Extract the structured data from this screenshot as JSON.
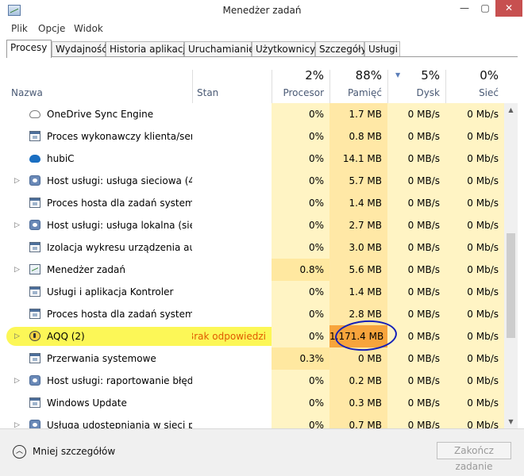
{
  "window": {
    "title": "Menedżer zadań",
    "minimize": "—",
    "maximize": "▢",
    "close": "✕"
  },
  "menu": {
    "items": [
      "Plik",
      "Opcje",
      "Widok"
    ]
  },
  "tabs": [
    "Procesy",
    "Wydajność",
    "Historia aplikacji",
    "Uruchamianie",
    "Użytkownicy",
    "Szczegóły",
    "Usługi"
  ],
  "active_tab": "Procesy",
  "columns": {
    "name": "Nazwa",
    "status": "Stan",
    "cpu": {
      "label": "Procesor",
      "percent": "2%"
    },
    "memory": {
      "label": "Pamięć",
      "percent": "88%"
    },
    "disk": {
      "label": "Dysk",
      "percent": "5%"
    },
    "network": {
      "label": "Sieć",
      "percent": "0%"
    }
  },
  "rows": [
    {
      "name": "OneDrive Sync Engine",
      "status": "",
      "cpu": "0%",
      "mem": "1.7 MB",
      "disk": "0 MB/s",
      "net": "0 Mb/s",
      "icon": "cloud-outline-icon",
      "expandable": false
    },
    {
      "name": "Proces wykonawczy klienta/ser...",
      "status": "",
      "cpu": "0%",
      "mem": "0.8 MB",
      "disk": "0 MB/s",
      "net": "0 Mb/s",
      "icon": "window-icon",
      "expandable": false
    },
    {
      "name": "hubiC",
      "status": "",
      "cpu": "0%",
      "mem": "14.1 MB",
      "disk": "0 MB/s",
      "net": "0 Mb/s",
      "icon": "cloud-icon",
      "expandable": false
    },
    {
      "name": "Host usługi: usługa sieciowa (4)",
      "status": "",
      "cpu": "0%",
      "mem": "5.7 MB",
      "disk": "0 MB/s",
      "net": "0 Mb/s",
      "icon": "gear-icon",
      "expandable": true
    },
    {
      "name": "Proces hosta dla zadań systemu...",
      "status": "",
      "cpu": "0%",
      "mem": "1.4 MB",
      "disk": "0 MB/s",
      "net": "0 Mb/s",
      "icon": "window-icon",
      "expandable": false
    },
    {
      "name": "Host usługi: usługa lokalna (sieć...",
      "status": "",
      "cpu": "0%",
      "mem": "2.7 MB",
      "disk": "0 MB/s",
      "net": "0 Mb/s",
      "icon": "gear-icon",
      "expandable": true
    },
    {
      "name": "Izolacja wykresu urządzenia aud...",
      "status": "",
      "cpu": "0%",
      "mem": "3.0 MB",
      "disk": "0 MB/s",
      "net": "0 Mb/s",
      "icon": "window-icon",
      "expandable": false
    },
    {
      "name": "Menedżer zadań",
      "status": "",
      "cpu": "0.8%",
      "mem": "5.6 MB",
      "disk": "0 MB/s",
      "net": "0 Mb/s",
      "icon": "task-manager-icon",
      "expandable": true
    },
    {
      "name": "Usługi i aplikacja Kontroler",
      "status": "",
      "cpu": "0%",
      "mem": "1.4 MB",
      "disk": "0 MB/s",
      "net": "0 Mb/s",
      "icon": "window-icon",
      "expandable": false
    },
    {
      "name": "Proces hosta dla zadań systemu...",
      "status": "",
      "cpu": "0%",
      "mem": "2.8 MB",
      "disk": "0 MB/s",
      "net": "0 Mb/s",
      "icon": "window-icon",
      "expandable": false
    },
    {
      "name": "AQQ (2)",
      "status": "Brak odpowiedzi",
      "cpu": "0%",
      "mem": "1,171.4 MB",
      "disk": "0 MB/s",
      "net": "0 Mb/s",
      "icon": "aqq-icon",
      "expandable": true
    },
    {
      "name": "Przerwania systemowe",
      "status": "",
      "cpu": "0.3%",
      "mem": "0 MB",
      "disk": "0 MB/s",
      "net": "0 Mb/s",
      "icon": "window-icon",
      "expandable": false
    },
    {
      "name": "Host usługi: raportowanie błędó...",
      "status": "",
      "cpu": "0%",
      "mem": "0.2 MB",
      "disk": "0 MB/s",
      "net": "0 Mb/s",
      "icon": "gear-icon",
      "expandable": true
    },
    {
      "name": "Windows Update",
      "status": "",
      "cpu": "0%",
      "mem": "0.3 MB",
      "disk": "0 MB/s",
      "net": "0 Mb/s",
      "icon": "window-icon",
      "expandable": false
    },
    {
      "name": "Usługa udostępniania w sieci pr...",
      "status": "",
      "cpu": "0%",
      "mem": "0.7 MB",
      "disk": "0 MB/s",
      "net": "0 Mb/s",
      "icon": "gear-icon",
      "expandable": true
    }
  ],
  "colors": {
    "cpu_bg": "#fff4c4",
    "cpu_bg_active": "#ffe8a0",
    "mem_bg": "#ffe8a6",
    "mem_bg_high": "#f7a43c",
    "disk_bg": "#fff4c4",
    "net_bg": "#fff4c4",
    "status_not_responding": "#e05a00",
    "highlight": "#fbf63a",
    "annotation_circle": "#1420b8"
  },
  "footer": {
    "fewer_details": "Mniej szczegółów",
    "end_task": "Zakończ zadanie"
  }
}
